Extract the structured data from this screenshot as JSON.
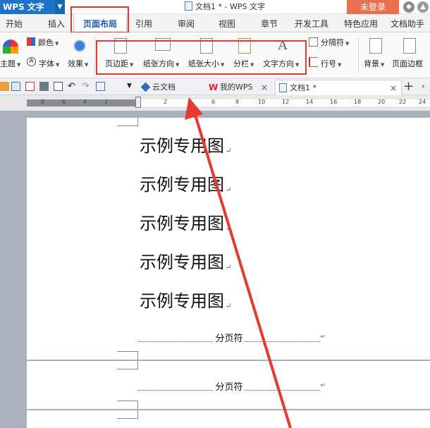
{
  "titlebar": {
    "app_name": "WPS 文字",
    "doc_title": "文档1 * - WPS 文字",
    "login_label": "未登录"
  },
  "tabs": [
    {
      "label": "开始"
    },
    {
      "label": "插入"
    },
    {
      "label": "页面布局"
    },
    {
      "label": "引用"
    },
    {
      "label": "审阅"
    },
    {
      "label": "视图"
    },
    {
      "label": "章节"
    },
    {
      "label": "开发工具"
    },
    {
      "label": "特色应用"
    },
    {
      "label": "文档助手"
    }
  ],
  "active_tab": "页面布局",
  "ribbon": {
    "theme_label": "主题",
    "color_label": "颜色",
    "font_label": "字体",
    "effect_label": "效果",
    "margin_label": "页边距",
    "orientation_label": "纸张方向",
    "size_label": "纸张大小",
    "columns_label": "分栏",
    "text_dir_label": "文字方向",
    "separator_label": "分隔符",
    "line_number_label": "行号",
    "background_label": "背景",
    "border_label": "页面边框"
  },
  "doc_tabs": {
    "cloud": "云文档",
    "mywps": "我的WPS",
    "doc1": "文档1 *",
    "add": "+"
  },
  "ruler_numbers": [
    "8",
    "6",
    "4",
    "2",
    "2",
    "4",
    "6",
    "8",
    "10",
    "12",
    "14",
    "16",
    "18",
    "20",
    "22",
    "24"
  ],
  "document": {
    "lines": [
      "示例专用图",
      "示例专用图",
      "示例专用图",
      "示例专用图",
      "示例专用图"
    ],
    "page_break_label": "分页符",
    "para_mark": "↵"
  },
  "colors": {
    "accent": "#1e73c8",
    "highlight": "#e53a2f",
    "login": "#e9704e"
  }
}
